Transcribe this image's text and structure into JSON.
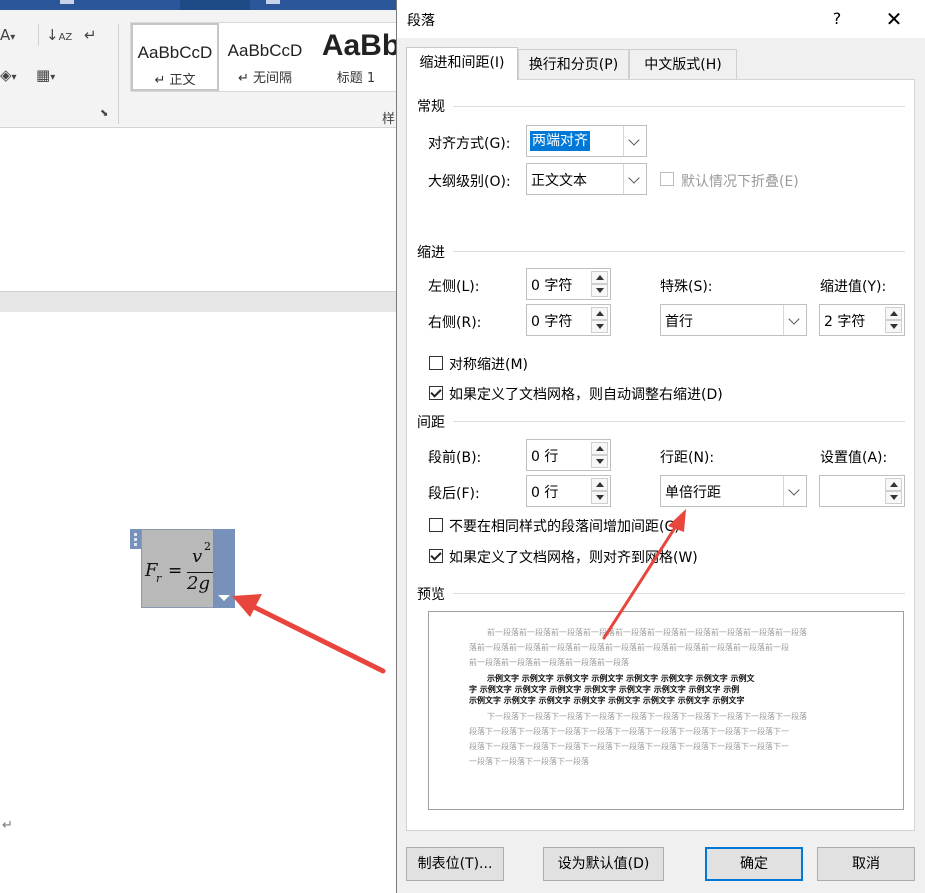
{
  "word": {
    "styles": [
      {
        "sample": "AaBbCcD",
        "name": "↵ 正文"
      },
      {
        "sample": "AaBbCcD",
        "name": "↵ 无间隔"
      },
      {
        "sample": "AaBb",
        "name": "标题 1"
      }
    ],
    "ribbon_group_label": "样",
    "paragraph_mark": "↵",
    "equation": {
      "lhs": "F",
      "sub": "r",
      "eq": "=",
      "num": "v",
      "sup": "2",
      "den": "2g"
    }
  },
  "dialog": {
    "title": "段落",
    "help": "?",
    "close": "✕",
    "tabs": [
      {
        "label": "缩进和间距(I)",
        "active": true
      },
      {
        "label": "换行和分页(P)",
        "active": false
      },
      {
        "label": "中文版式(H)",
        "active": false
      }
    ],
    "general": {
      "title": "常规",
      "alignment_label": "对齐方式(G):",
      "alignment_value": "两端对齐",
      "outline_label": "大纲级别(O):",
      "outline_value": "正文文本",
      "collapse_label": "默认情况下折叠(E)"
    },
    "indent": {
      "title": "缩进",
      "left_label": "左侧(L):",
      "left_value": "0 字符",
      "right_label": "右侧(R):",
      "right_value": "0 字符",
      "special_label": "特殊(S):",
      "special_value": "首行",
      "by_label": "缩进值(Y):",
      "by_value": "2 字符",
      "mirror_label": "对称缩进(M)",
      "grid_label": "如果定义了文档网格，则自动调整右缩进(D)"
    },
    "spacing": {
      "title": "间距",
      "before_label": "段前(B):",
      "before_value": "0 行",
      "after_label": "段后(F):",
      "after_value": "0 行",
      "line_label": "行距(N):",
      "line_value": "单倍行距",
      "at_label": "设置值(A):",
      "at_value": "",
      "no_space_label": "不要在相同样式的段落间增加间距(C)",
      "snap_label": "如果定义了文档网格，则对齐到网格(W)"
    },
    "preview": {
      "title": "预览",
      "lines": [
        {
          "text": "前一段落前一段落前一段落前一段落前一段落前一段落前一段落前一段落前一段落前一段落",
          "style": "grey",
          "indent": true
        },
        {
          "text": "落前一段落前一段落前一段落前一段落前一段落前一段落前一段落前一段落前一段落前一段",
          "style": "grey",
          "indent": false
        },
        {
          "text": "前一段落前一段落前一段落前一段落前一段落",
          "style": "grey",
          "indent": false
        },
        {
          "text": "示例文字  示例文字  示例文字  示例文字  示例文字  示例文字  示例文字  示例文",
          "style": "dark",
          "indent": true
        },
        {
          "text": "字  示例文字  示例文字  示例文字  示例文字  示例文字  示例文字  示例文字  示例",
          "style": "dark",
          "indent": false
        },
        {
          "text": "示例文字  示例文字  示例文字  示例文字  示例文字  示例文字  示例文字  示例文字",
          "style": "dark",
          "indent": false
        },
        {
          "text": "下一段落下一段落下一段落下一段落下一段落下一段落下一段落下一段落下一段落下一段落",
          "style": "grey",
          "indent": true
        },
        {
          "text": "段落下一段落下一段落下一段落下一段落下一段落下一段落下一段落下一段落下一段落下一",
          "style": "grey",
          "indent": false
        },
        {
          "text": "段落下一段落下一段落下一段落下一段落下一段落下一段落下一段落下一段落下一段落下一",
          "style": "grey",
          "indent": false
        },
        {
          "text": "一段落下一段落下一段落下一段落",
          "style": "grey",
          "indent": false
        }
      ]
    },
    "buttons": {
      "tabs": "制表位(T)...",
      "default": "设为默认值(D)",
      "ok": "确定",
      "cancel": "取消"
    }
  },
  "colors": {
    "accent": "#0078d7",
    "arrow": "#e8453c",
    "ribbon_tabs": "#2b579a"
  }
}
